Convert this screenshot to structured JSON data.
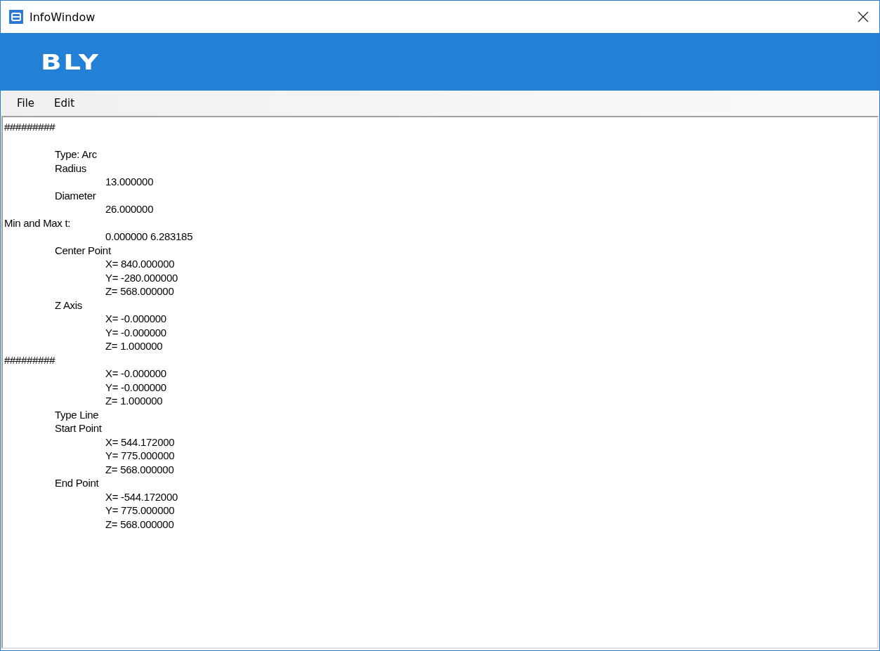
{
  "window": {
    "title": "InfoWindow"
  },
  "banner": {
    "logo": "BLY"
  },
  "menu": [
    {
      "label": "File"
    },
    {
      "label": "Edit"
    }
  ],
  "text_area": {
    "lines": [
      "#########",
      "\n\tType: Arc",
      "\tRadius",
      "\t\t13.000000",
      "\tDiameter",
      "\t\t26.000000",
      "Min and Max t:",
      "\t\t0.000000 6.283185",
      "\tCenter Point",
      "\t\tX= 840.000000",
      "\t\tY= -280.000000",
      "\t\tZ= 568.000000",
      "\tZ Axis",
      "\t\tX= -0.000000",
      "\t\tY= -0.000000",
      "\t\tZ= 1.000000",
      "#########",
      "\t\tX= -0.000000",
      "\t\tY= -0.000000",
      "\t\tZ= 1.000000",
      "\tType Line",
      "\tStart Point",
      "\t\tX= 544.172000",
      "\t\tY= 775.000000",
      "\t\tZ= 568.000000",
      "\tEnd Point",
      "\t\tX= -544.172000",
      "\t\tY= 775.000000",
      "\t\tZ= 568.000000"
    ]
  }
}
